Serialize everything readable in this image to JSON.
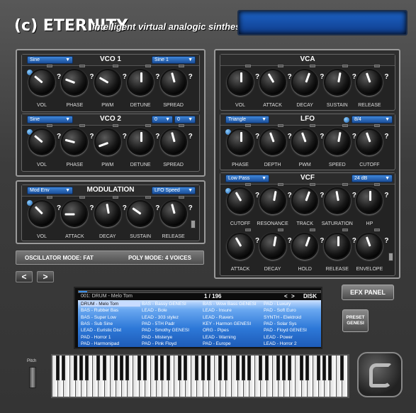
{
  "app": {
    "title": "(c) ETERNITY",
    "subtitle": "intelligent virtual analogic sinthesizer."
  },
  "vco1": {
    "title": "VCO 1",
    "wave": "Sine",
    "wave2": "Sine 1",
    "labels": [
      "VOL",
      "PHASE",
      "PWM",
      "DETUNE",
      "SPREAD"
    ]
  },
  "vco2": {
    "title": "VCO 2",
    "wave": "Sine",
    "oct": "0",
    "semi": "0",
    "labels": [
      "VOL",
      "PHASE",
      "PWM",
      "DETUNE",
      "SPREAD"
    ]
  },
  "modulation": {
    "title": "MODULATION",
    "source": "Mod Env",
    "target": "LFO Speed",
    "labels": [
      "VOL",
      "ATTACK",
      "DECAY",
      "SUSTAIN",
      "RELEASE"
    ]
  },
  "vca": {
    "title": "VCA",
    "labels": [
      "VOL",
      "ATTACK",
      "DECAY",
      "SUSTAIN",
      "RELEASE"
    ]
  },
  "lfo": {
    "title": "LFO",
    "wave": "Triangle",
    "sync": "8/4",
    "labels": [
      "PHASE",
      "DEPTH",
      "PWM",
      "SPEED",
      "CUTOFF"
    ]
  },
  "vcf": {
    "title": "VCF",
    "type": "Low Pass",
    "slope": "24 dB",
    "labels1": [
      "CUTOFF",
      "RESONANCE",
      "TRACK",
      "SATURATION",
      "HP"
    ],
    "labels2": [
      "ATTACK",
      "DECAY",
      "HOLD",
      "RELEASE",
      "ENVELOPE"
    ]
  },
  "mode": {
    "osc": "OSCILLATOR MODE: FAT",
    "poly": "POLY MODE: 4 VOICES"
  },
  "nav": {
    "prev": "<",
    "next": ">"
  },
  "browser": {
    "current": "001: DRUM - Melo Tom",
    "page": "1 / 196",
    "prev": "<",
    "next": ">",
    "disk": "DISK",
    "columns": [
      [
        "DRUM - Melo Tom",
        "BAS - Rubber Bas",
        "BAS - Super Low",
        "BAS - Sub Sine",
        "LEAD - Euristic Dist",
        "PAD - Horror 1",
        "PAD - Harmonipad"
      ],
      [
        "BAS - Bassy GENESI",
        "LEAD - Bole",
        "LEAD - 303 stylez",
        "PAD - 5TH Padr",
        "PAD - Smothy  GENESI",
        "PAD - Misterye",
        "PAD - Pink Floyd"
      ],
      [
        "BAS - Wow Bass GENESI",
        "LEAD - Insure",
        "LEAD - Ravers",
        "KEY - Harmon GENESI",
        "ORG - Pipes",
        "LEAD - Warning",
        "PAD - Europe"
      ],
      [
        "PAD - Luxury",
        "PAD - Soft Euro",
        "SYNTH - Elektroid",
        "PAD - Solar Sys",
        "PAD - Floyd GENESI",
        "LEAD - Power",
        "LEAD - Horror 2"
      ]
    ]
  },
  "buttons": {
    "efx": "EFX PANEL",
    "preset1": "PRESET",
    "preset2": "GENESI",
    "pitch": "Pitch",
    "help": "?"
  }
}
